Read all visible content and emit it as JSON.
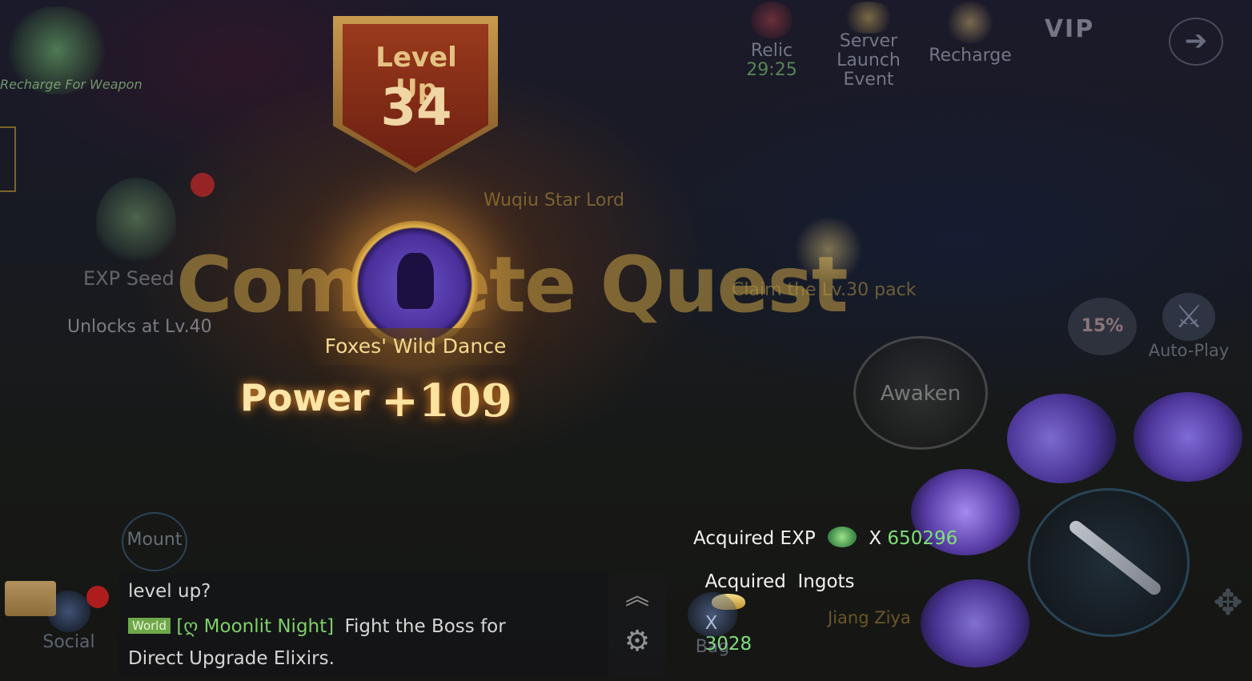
{
  "recharge_weapon": "Recharge For Weapon",
  "top": {
    "relic_label": "Relic",
    "relic_timer": "29:25",
    "server_launch": "Server Launch Event",
    "recharge": "Recharge",
    "vip": "VIP",
    "exit_icon": "arrow-right-icon"
  },
  "level_up": {
    "label": "Level Up",
    "level": "34"
  },
  "exp_seed": {
    "label": "EXP Seed",
    "unlock": "Unlocks at Lv.40"
  },
  "quest_overlay": {
    "complete_quest": "Complete Quest",
    "npc_name": "Wuqiu Star Lord"
  },
  "skill_unlock": {
    "name": "Foxes' Wild Dance",
    "power_label": "Power",
    "power_value": "+109"
  },
  "claim_pack": "Claim the Lv.30 pack",
  "hud": {
    "percent": "15%",
    "auto_play": "Auto-Play",
    "awaken": "Awaken",
    "mount": "Mount",
    "bag": "Bag",
    "social": "Social",
    "jiang_ziya": "Jiang Ziya"
  },
  "rewards": {
    "exp_label": "Acquired EXP",
    "exp_value": "650296",
    "ingots_label": "Acquired  Ingots",
    "ingots_value": "3028",
    "multiplier": "X",
    "value_color": "#7fe07a"
  },
  "chat": {
    "line1": "level up?",
    "channel": "World",
    "player": "[ღ Moonlit Night]",
    "message": "Fight the Boss for",
    "line3": "Direct Upgrade Elixirs."
  }
}
